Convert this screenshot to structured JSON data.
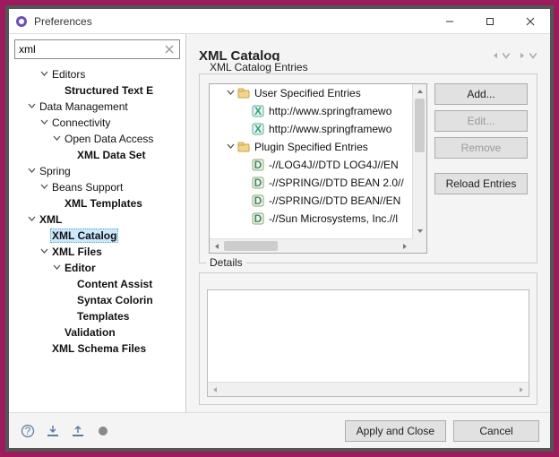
{
  "window": {
    "title": "Preferences"
  },
  "sidebar": {
    "search_value": "xml",
    "items": [
      {
        "label": "Editors",
        "depth": 1,
        "expandable": true,
        "bold": false
      },
      {
        "label": "Structured Text E",
        "depth": 2,
        "expandable": false,
        "bold": true
      },
      {
        "label": "Data Management",
        "depth": 0,
        "expandable": true,
        "bold": false
      },
      {
        "label": "Connectivity",
        "depth": 1,
        "expandable": true,
        "bold": false
      },
      {
        "label": "Open Data Access",
        "depth": 2,
        "expandable": true,
        "bold": false
      },
      {
        "label": "XML Data Set",
        "depth": 3,
        "expandable": false,
        "bold": true
      },
      {
        "label": "Spring",
        "depth": 0,
        "expandable": true,
        "bold": false
      },
      {
        "label": "Beans Support",
        "depth": 1,
        "expandable": true,
        "bold": false
      },
      {
        "label": "XML Templates",
        "depth": 2,
        "expandable": false,
        "bold": true
      },
      {
        "label": "XML",
        "depth": 0,
        "expandable": true,
        "bold": true
      },
      {
        "label": "XML Catalog",
        "depth": 1,
        "expandable": false,
        "bold": true,
        "selected": true
      },
      {
        "label": "XML Files",
        "depth": 1,
        "expandable": true,
        "bold": true
      },
      {
        "label": "Editor",
        "depth": 2,
        "expandable": true,
        "bold": true
      },
      {
        "label": "Content Assist",
        "depth": 3,
        "expandable": false,
        "bold": true
      },
      {
        "label": "Syntax Colorin",
        "depth": 3,
        "expandable": false,
        "bold": true
      },
      {
        "label": "Templates",
        "depth": 3,
        "expandable": false,
        "bold": true
      },
      {
        "label": "Validation",
        "depth": 2,
        "expandable": false,
        "bold": true
      },
      {
        "label": "XML Schema Files",
        "depth": 1,
        "expandable": false,
        "bold": true
      }
    ]
  },
  "page": {
    "title": "XML Catalog",
    "entries_group": "XML Catalog Entries",
    "details_group": "Details",
    "buttons": {
      "add": "Add...",
      "edit": "Edit...",
      "remove": "Remove",
      "reload": "Reload Entries"
    },
    "catalog": [
      {
        "label": "User Specified Entries",
        "depth": 0,
        "expandable": true,
        "icon": "folder"
      },
      {
        "label": "http://www.springframewo",
        "depth": 1,
        "expandable": false,
        "icon": "x"
      },
      {
        "label": "http://www.springframewo",
        "depth": 1,
        "expandable": false,
        "icon": "x"
      },
      {
        "label": "Plugin Specified Entries",
        "depth": 0,
        "expandable": true,
        "icon": "folder"
      },
      {
        "label": "-//LOG4J//DTD LOG4J//EN",
        "depth": 1,
        "expandable": false,
        "icon": "d"
      },
      {
        "label": "-//SPRING//DTD BEAN 2.0//",
        "depth": 1,
        "expandable": false,
        "icon": "d"
      },
      {
        "label": "-//SPRING//DTD BEAN//EN",
        "depth": 1,
        "expandable": false,
        "icon": "d"
      },
      {
        "label": "-//Sun Microsystems, Inc.//l",
        "depth": 1,
        "expandable": false,
        "icon": "d"
      }
    ]
  },
  "footer": {
    "apply": "Apply and Close",
    "cancel": "Cancel"
  }
}
